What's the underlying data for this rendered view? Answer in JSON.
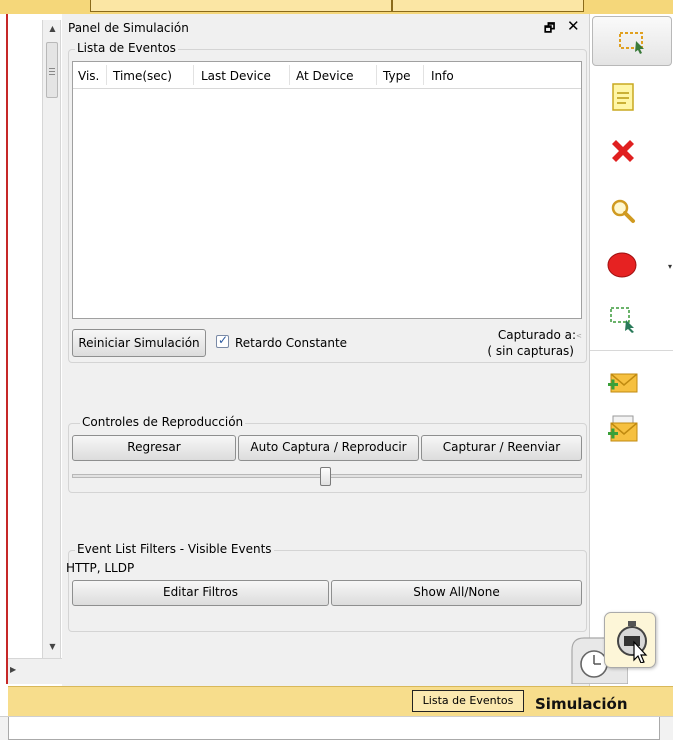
{
  "panel": {
    "title": "Panel de Simulación",
    "float_icon": "🗗",
    "close_icon": "✕"
  },
  "event_list": {
    "group_title": "Lista de Eventos",
    "columns": [
      "Vis.",
      "Time(sec)",
      "Last Device",
      "At Device",
      "Type",
      "Info"
    ],
    "rows": []
  },
  "sim_controls": {
    "reset_label": "Reiniciar Simulación",
    "constant_delay_label": "Retardo Constante",
    "constant_delay_checked": true,
    "captured_label": "Capturado a:",
    "captured_value": "( sin capturas)"
  },
  "playback": {
    "group_title": "Controles de Reproducción",
    "back_label": "Regresar",
    "auto_label": "Auto Captura / Reproducir",
    "capture_label": "Capturar / Reenviar"
  },
  "filters": {
    "group_title": "Event List Filters - Visible Events",
    "visible_events": "HTTP, LLDP",
    "edit_label": "Editar Filtros",
    "show_all_label": "Show All/None"
  },
  "statusbar": {
    "tab_label": "Lista de Eventos",
    "mode_label": "Simulación"
  },
  "toolbar": {
    "tools": [
      "select-icon",
      "note-icon",
      "delete-icon",
      "inspect-icon",
      "draw-ellipse-icon",
      "resize-icon",
      "add-simple-pdu-icon",
      "add-complex-pdu-icon"
    ]
  },
  "colors": {
    "status_yellow": "#f7dd8c",
    "delete_red": "#e02020",
    "ellipse_red": "#e62222"
  }
}
